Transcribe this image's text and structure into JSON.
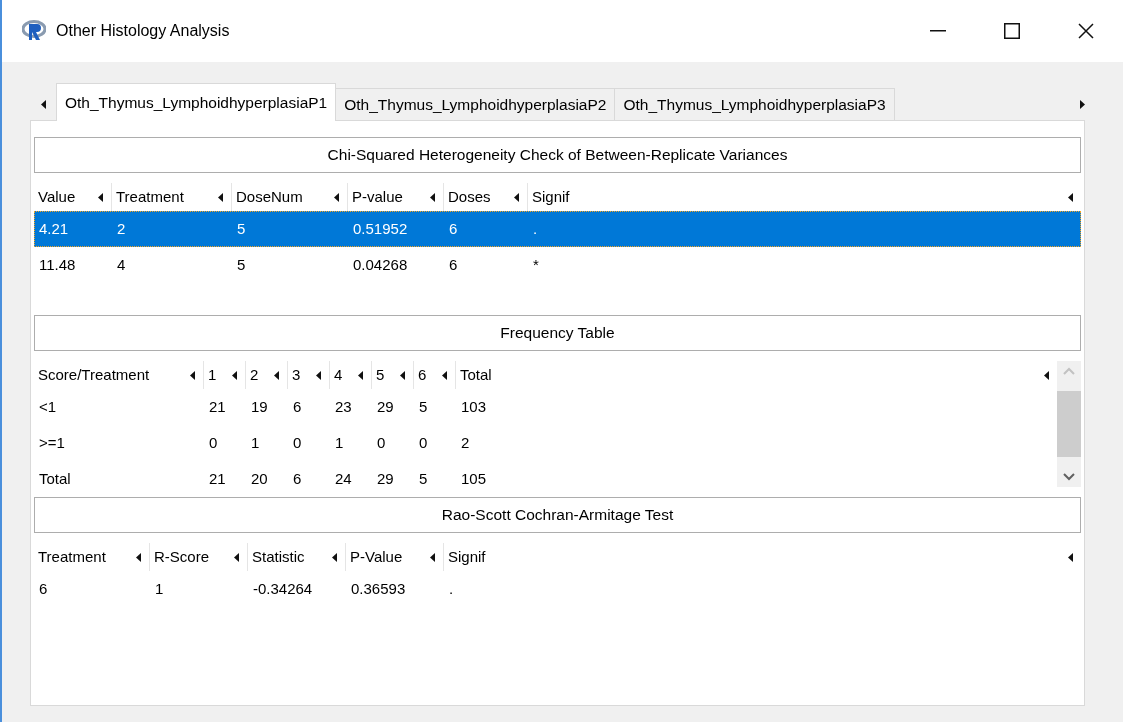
{
  "window": {
    "title": "Other Histology Analysis"
  },
  "tabs": [
    {
      "label": "Oth_Thymus_LymphoidhyperplasiaP1",
      "selected": true
    },
    {
      "label": "Oth_Thymus_LymphoidhyperplasiaP2",
      "selected": false
    },
    {
      "label": "Oth_Thymus_LymphoidhyperplasiaP3",
      "selected": false
    }
  ],
  "sections": [
    {
      "title": "Chi-Squared Heterogeneity Check of Between-Replicate Variances",
      "scrollbar": false,
      "columns": [
        "Value",
        "Treatment",
        "DoseNum",
        "P-value",
        "Doses",
        "Signif"
      ],
      "rows": [
        {
          "cells": [
            "4.21",
            "2",
            "5",
            "0.51952",
            "6",
            "."
          ],
          "selected": true
        },
        {
          "cells": [
            "11.48",
            "4",
            "5",
            "0.04268",
            "6",
            "*"
          ],
          "selected": false
        }
      ]
    },
    {
      "title": "Frequency Table",
      "scrollbar": true,
      "columns": [
        "Score/Treatment",
        "1",
        "2",
        "3",
        "4",
        "5",
        "6",
        "Total"
      ],
      "rows": [
        {
          "cells": [
            "<1",
            "21",
            "19",
            "6",
            "23",
            "29",
            "5",
            "103"
          ],
          "selected": false
        },
        {
          "cells": [
            ">=1",
            "0",
            "1",
            "0",
            "1",
            "0",
            "0",
            "2"
          ],
          "selected": false
        },
        {
          "cells": [
            "Total",
            "21",
            "20",
            "6",
            "24",
            "29",
            "5",
            "105"
          ],
          "selected": false
        }
      ]
    },
    {
      "title": "Rao-Scott Cochran-Armitage Test",
      "scrollbar": false,
      "columns": [
        "Treatment",
        "R-Score",
        "Statistic",
        "P-Value",
        "Signif"
      ],
      "rows": [
        {
          "cells": [
            "6",
            "1",
            "-0.34264",
            "0.36593",
            "."
          ],
          "selected": false
        }
      ]
    }
  ]
}
